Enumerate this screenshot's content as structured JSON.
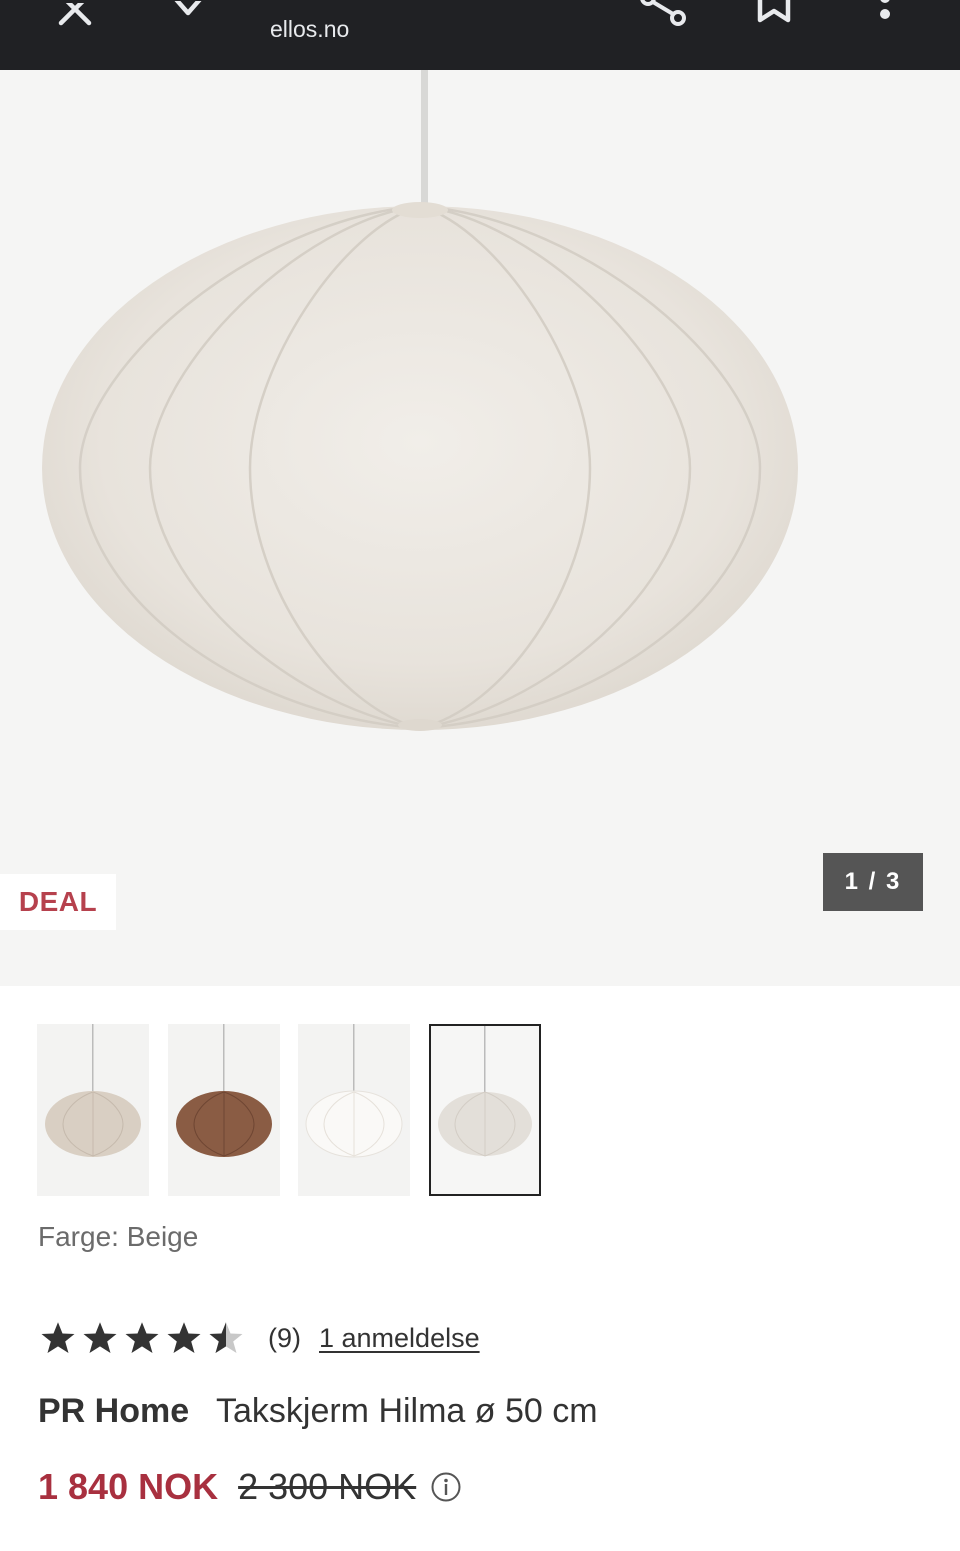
{
  "browser": {
    "url": "ellos.no",
    "icons": [
      "close-icon",
      "chevron-down-icon",
      "share-icon",
      "bookmark-icon",
      "more-vert-icon"
    ]
  },
  "hero": {
    "badge": "DEAL",
    "counter": "1 / 3"
  },
  "thumbnails": [
    {
      "color": "#d9cfc3",
      "name": "beige"
    },
    {
      "color": "#8a5c44",
      "name": "brown"
    },
    {
      "color": "#f3f1ee",
      "name": "white"
    },
    {
      "color": "#e3dfd9",
      "name": "light-beige",
      "selected": true
    }
  ],
  "color": {
    "label": "Farge: Beige"
  },
  "rating": {
    "value": 4.5,
    "max": 5,
    "count": "(9)",
    "reviews_link": "1 anmeldelse"
  },
  "product": {
    "brand": "PR Home",
    "name": "Takskjerm Hilma ø 50 cm"
  },
  "price": {
    "current": "1 840 NOK",
    "original": "2 300 NOK"
  },
  "colors": {
    "topbar": "#202124",
    "deal": "#b6414d",
    "sale_price": "#a8303f"
  }
}
